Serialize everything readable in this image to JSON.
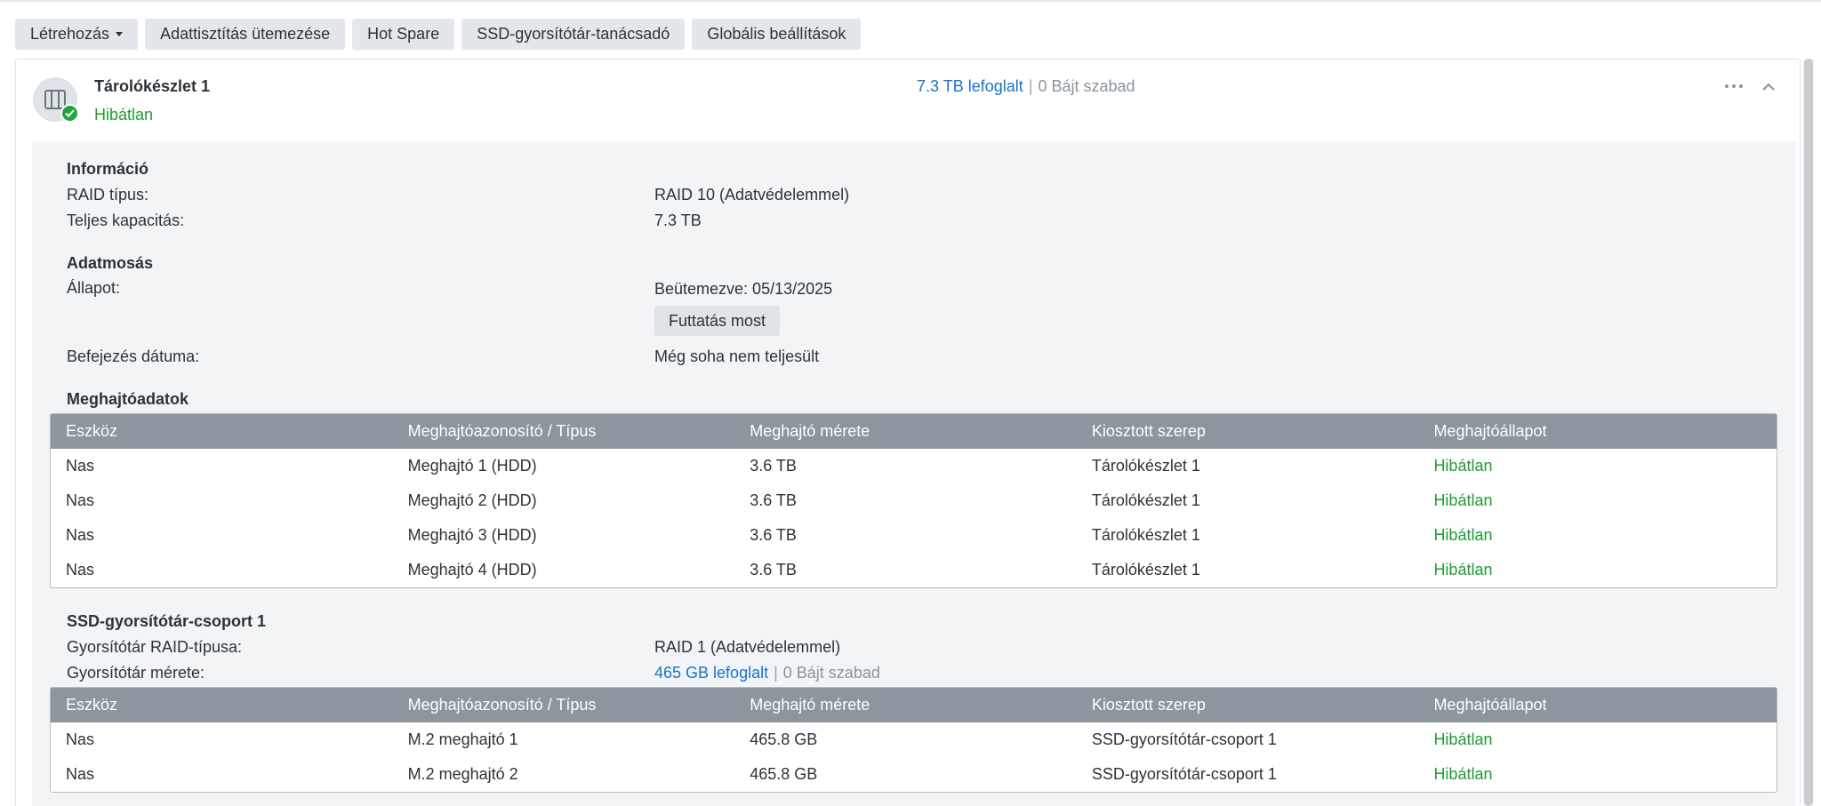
{
  "toolbar": {
    "create_label": "Létrehozás",
    "scrub_schedule_label": "Adattisztítás ütemezése",
    "hot_spare_label": "Hot Spare",
    "ssd_advisor_label": "SSD-gyorsítótár-tanácsadó",
    "global_settings_label": "Globális beállítások"
  },
  "pool": {
    "title": "Tárolókészlet 1",
    "status": "Hibátlan",
    "used": "7.3 TB lefoglalt",
    "separator": "|",
    "free": "0 Bájt szabad",
    "icon": "storage-pool-icon"
  },
  "info": {
    "title": "Információ",
    "raid_type_label": "RAID típus:",
    "raid_type_value": "RAID 10 (Adatvédelemmel)",
    "capacity_label": "Teljes kapacitás:",
    "capacity_value": "7.3 TB"
  },
  "scrubbing": {
    "title": "Adatmosás",
    "state_label": "Állapot:",
    "state_value": "Beütemezve: 05/13/2025",
    "run_now_label": "Futtatás most",
    "completion_label": "Befejezés dátuma:",
    "completion_value": "Még soha nem teljesült"
  },
  "drives": {
    "title": "Meghajtóadatok",
    "columns": [
      "Eszköz",
      "Meghajtóazonosító / Típus",
      "Meghajtó mérete",
      "Kiosztott szerep",
      "Meghajtóállapot"
    ],
    "rows": [
      [
        "Nas",
        "Meghajtó 1 (HDD)",
        "3.6 TB",
        "Tárolókészlet 1",
        "Hibátlan"
      ],
      [
        "Nas",
        "Meghajtó 2 (HDD)",
        "3.6 TB",
        "Tárolókészlet 1",
        "Hibátlan"
      ],
      [
        "Nas",
        "Meghajtó 3 (HDD)",
        "3.6 TB",
        "Tárolókészlet 1",
        "Hibátlan"
      ],
      [
        "Nas",
        "Meghajtó 4 (HDD)",
        "3.6 TB",
        "Tárolókészlet 1",
        "Hibátlan"
      ]
    ]
  },
  "cache": {
    "title": "SSD-gyorsítótár-csoport 1",
    "raid_label": "Gyorsítótár RAID-típusa:",
    "raid_value": "RAID 1 (Adatvédelemmel)",
    "size_label": "Gyorsítótár mérete:",
    "size_used": "465 GB lefoglalt",
    "size_separator": "|",
    "size_free": "0 Bájt szabad",
    "columns": [
      "Eszköz",
      "Meghajtóazonosító / Típus",
      "Meghajtó mérete",
      "Kiosztott szerep",
      "Meghajtóállapot"
    ],
    "rows": [
      [
        "Nas",
        "M.2 meghajtó 1",
        "465.8 GB",
        "SSD-gyorsítótár-csoport 1",
        "Hibátlan"
      ],
      [
        "Nas",
        "M.2 meghajtó 2",
        "465.8 GB",
        "SSD-gyorsítótár-csoport 1",
        "Hibátlan"
      ]
    ]
  },
  "colors": {
    "healthy": "#1f9c31",
    "link": "#1a73c8",
    "table_header": "#8d959e"
  }
}
